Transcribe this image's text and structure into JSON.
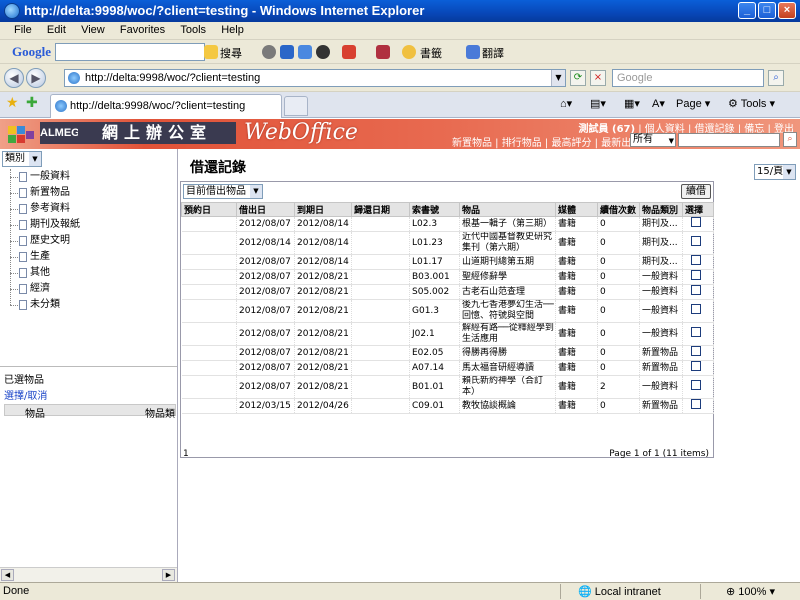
{
  "window": {
    "title": "http://delta:9998/woc/?client=testing - Windows Internet Explorer"
  },
  "menu": [
    "File",
    "Edit",
    "View",
    "Favorites",
    "Tools",
    "Help"
  ],
  "google_toolbar": {
    "logo": "Google",
    "search_label": "搜尋",
    "bookmarks_label": "書籤",
    "translate_label": "翻譯"
  },
  "address": {
    "url": "http://delta:9998/woc/?client=testing",
    "search_placeholder": "Google"
  },
  "tab": {
    "label": "http://delta:9998/woc/?client=testing",
    "page_label": "Page",
    "tools_label": "Tools"
  },
  "header": {
    "brand": "ALMEGA",
    "brand_cn": "網上辦公室",
    "product": "WebOffice",
    "user": "測試員 (67)",
    "user_links": [
      "個人資料",
      "借還記錄",
      "備忘",
      "登出"
    ],
    "category_links": [
      "新置物品",
      "排行物品",
      "最高評分",
      "最新出版"
    ],
    "search_scope": "所有"
  },
  "sidebar": {
    "category_select": "類別",
    "tree": [
      "一般資料",
      "新置物品",
      "參考資料",
      "期刊及報紙",
      "歷史文明",
      "生產",
      "其他",
      "經濟",
      "未分類"
    ],
    "selected_header": "已選物品",
    "select_toggle": "選擇/取消",
    "grid_columns": [
      "物品",
      "物品類"
    ]
  },
  "main": {
    "title": "借還記錄",
    "page_size": "15/頁",
    "filter": "目前借出物品",
    "renew_button": "續借",
    "columns": [
      "預約日",
      "借出日",
      "到期日",
      "歸還日期",
      "索書號",
      "物品",
      "媒體",
      "續借次數",
      "物品類別",
      "選擇"
    ],
    "rows": [
      {
        "reserve": "",
        "out": "2012/08/07",
        "due": "2012/08/14",
        "returned": "",
        "call": "L02.3",
        "item": "根基一輯子（第三期）",
        "media": "書籍",
        "renew": "0",
        "type": "期刊及..."
      },
      {
        "reserve": "",
        "out": "2012/08/14",
        "due": "2012/08/14",
        "returned": "",
        "call": "L01.23",
        "item": "近代中國基督教史研究集刊（第六期）",
        "media": "書籍",
        "renew": "0",
        "type": "期刊及..."
      },
      {
        "reserve": "",
        "out": "2012/08/07",
        "due": "2012/08/14",
        "returned": "",
        "call": "L01.17",
        "item": "山道期刊總第五期",
        "media": "書籍",
        "renew": "0",
        "type": "期刊及..."
      },
      {
        "reserve": "",
        "out": "2012/08/07",
        "due": "2012/08/21",
        "returned": "",
        "call": "B03.001",
        "item": "聖經修辭學",
        "media": "書籍",
        "renew": "0",
        "type": "一般資料"
      },
      {
        "reserve": "",
        "out": "2012/08/07",
        "due": "2012/08/21",
        "returned": "",
        "call": "S05.002",
        "item": "古老石山范查理",
        "media": "書籍",
        "renew": "0",
        "type": "一般資料"
      },
      {
        "reserve": "",
        "out": "2012/08/07",
        "due": "2012/08/21",
        "returned": "",
        "call": "G01.3",
        "item": "後九七香港夢幻生活──回憶、符號與空間",
        "media": "書籍",
        "renew": "0",
        "type": "一般資料"
      },
      {
        "reserve": "",
        "out": "2012/08/07",
        "due": "2012/08/21",
        "returned": "",
        "call": "J02.1",
        "item": "解經有路──從釋經學到生活應用",
        "media": "書籍",
        "renew": "0",
        "type": "一般資料"
      },
      {
        "reserve": "",
        "out": "2012/08/07",
        "due": "2012/08/21",
        "returned": "",
        "call": "E02.05",
        "item": "得勝再得勝",
        "media": "書籍",
        "renew": "0",
        "type": "新置物品"
      },
      {
        "reserve": "",
        "out": "2012/08/07",
        "due": "2012/08/21",
        "returned": "",
        "call": "A07.14",
        "item": "馬太福音研經導讀",
        "media": "書籍",
        "renew": "0",
        "type": "新置物品"
      },
      {
        "reserve": "",
        "out": "2012/08/07",
        "due": "2012/08/21",
        "returned": "",
        "call": "B01.01",
        "item": "賴氏新約神學（合訂本）",
        "media": "書籍",
        "renew": "2",
        "type": "一般資料"
      },
      {
        "reserve": "",
        "out": "2012/03/15",
        "due": "2012/04/26",
        "returned": "",
        "call": "C09.01",
        "item": "教牧協談概論",
        "media": "書籍",
        "renew": "0",
        "type": "新置物品"
      }
    ],
    "footer_left": "1",
    "footer_right": "Page 1 of 1 (11 items)"
  },
  "status": {
    "left": "Done",
    "zone": "Local intranet",
    "zoom": "100%"
  },
  "colors": {
    "header_red": "#e05238",
    "ie_blue": "#0847b8"
  }
}
